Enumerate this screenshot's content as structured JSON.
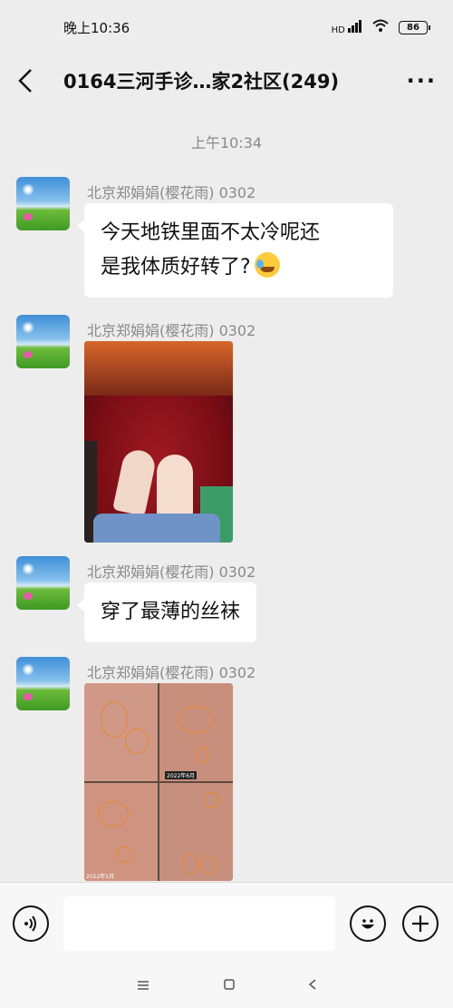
{
  "status": {
    "time": "晚上10:36",
    "network": "HD",
    "battery": "86"
  },
  "header": {
    "title": "0164三河手诊…家2社区(249)"
  },
  "timestamp": "上午10:34",
  "messages": [
    {
      "sender": "北京郑娟娟(樱花雨) 0302",
      "text_line1": "今天地铁里面不太冷呢还",
      "text_line2": "是我体质好转了?"
    },
    {
      "sender": "北京郑娟娟(樱花雨) 0302"
    },
    {
      "sender": "北京郑娟娟(樱花雨) 0302",
      "text": "穿了最薄的丝袜"
    },
    {
      "sender": "北京郑娟娟(樱花雨) 0302",
      "photo_caption1": "2022年6月",
      "photo_caption2": "2022年5月"
    }
  ],
  "input": {
    "placeholder": ""
  },
  "colors": {
    "background": "#ededed",
    "bubble": "#ffffff",
    "meta_text": "#8a8a8a"
  }
}
